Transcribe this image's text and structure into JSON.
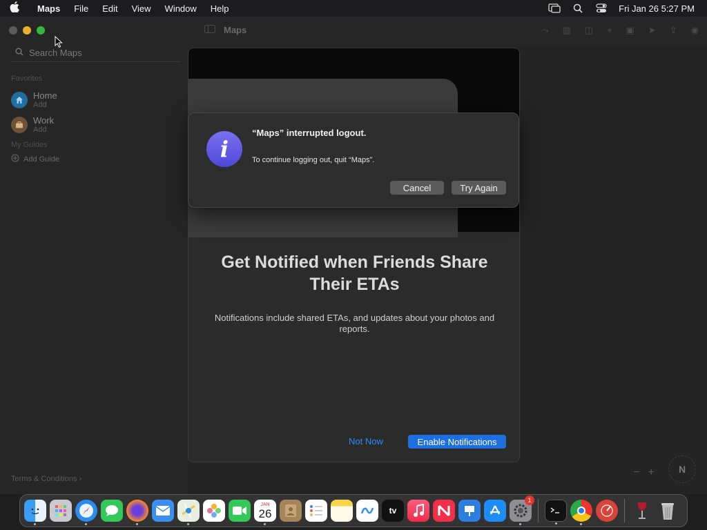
{
  "menubar": {
    "app_name": "Maps",
    "items": [
      "File",
      "Edit",
      "View",
      "Window",
      "Help"
    ],
    "datetime": "Fri Jan 26  5:27 PM"
  },
  "sidebar": {
    "search_placeholder": "Search Maps",
    "favorites_label": "Favorites",
    "favorites": [
      {
        "title": "Home",
        "subtitle": "Add",
        "icon": "house-icon",
        "color": "#1f8fd6"
      },
      {
        "title": "Work",
        "subtitle": "Add",
        "icon": "briefcase-icon",
        "color": "#a67a4a"
      }
    ],
    "guides_label": "My Guides",
    "add_guide": "Add Guide",
    "terms": "Terms & Conditions"
  },
  "toolbar": {
    "title": "Maps"
  },
  "sheet": {
    "title_line1": "Get Notified when Friends Share",
    "title_line2": "Their ETAs",
    "description": "Notifications include shared ETAs, and updates about your photos and reports.",
    "not_now": "Not Now",
    "enable": "Enable Notifications"
  },
  "alert": {
    "title": "“Maps” interrupted logout.",
    "message": "To continue logging out, quit “Maps”.",
    "cancel": "Cancel",
    "try_again": "Try Again"
  },
  "map": {
    "compass": "N"
  },
  "dock": {
    "calendar_month": "JAN",
    "calendar_day": "26",
    "settings_badge": "1",
    "tv_label": "tv",
    "apps": [
      "finder-icon",
      "launchpad-icon",
      "safari-icon",
      "messages-icon",
      "firefox-icon",
      "mail-icon",
      "maps-icon",
      "photos-icon",
      "facetime-icon",
      "calendar-icon",
      "contacts-icon",
      "reminders-icon",
      "notes-icon",
      "freeform-icon",
      "tv-icon",
      "music-icon",
      "news-icon",
      "keynote-icon",
      "app-store-icon",
      "system-settings-icon",
      "terminal-icon",
      "chrome-icon",
      "directory-utility-icon",
      "wine-icon",
      "trash-icon"
    ]
  }
}
